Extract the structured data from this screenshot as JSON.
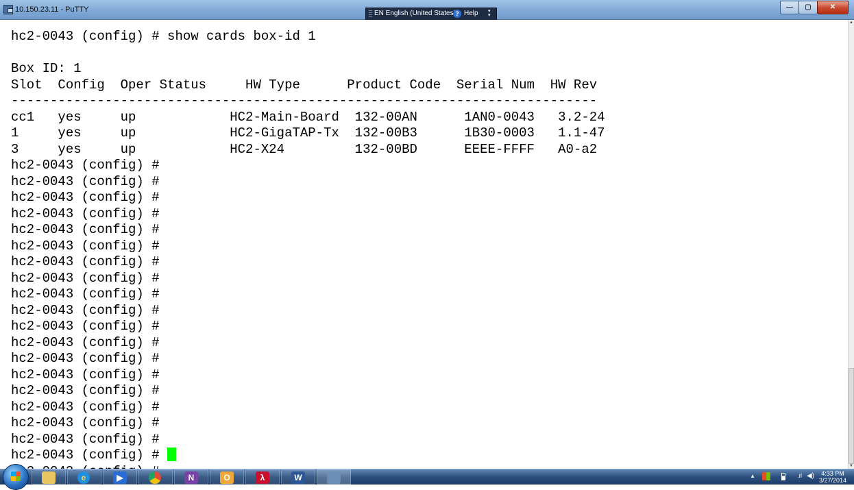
{
  "window": {
    "title": "10.150.23.11 - PuTTY",
    "minimize_icon": "minimize-icon",
    "maximize_icon": "maximize-icon",
    "close_icon": "close-icon"
  },
  "language_bar": {
    "language": "EN English (United States)",
    "help_label": "Help"
  },
  "terminal": {
    "lines": [
      "hc2-0043 (config) # show cards box-id 1",
      "",
      "Box ID: 1",
      "Slot  Config  Oper Status     HW Type      Product Code  Serial Num  HW Rev",
      "---------------------------------------------------------------------------",
      "cc1   yes     up            HC2-Main-Board  132-00AN      1AN0-0043   3.2-24",
      "1     yes     up            HC2-GigaTAP-Tx  132-00B3      1B30-0003   1.1-47",
      "3     yes     up            HC2-X24         132-00BD      EEEE-FFFF   A0-a2",
      "hc2-0043 (config) #",
      "hc2-0043 (config) #",
      "hc2-0043 (config) #",
      "hc2-0043 (config) #",
      "hc2-0043 (config) #",
      "hc2-0043 (config) #",
      "hc2-0043 (config) #",
      "hc2-0043 (config) #",
      "hc2-0043 (config) #",
      "hc2-0043 (config) #",
      "hc2-0043 (config) #",
      "hc2-0043 (config) #",
      "hc2-0043 (config) #",
      "hc2-0043 (config) #",
      "hc2-0043 (config) #",
      "hc2-0043 (config) #",
      "hc2-0043 (config) #",
      "hc2-0043 (config) #",
      "hc2-0043 (config) # ",
      "hc2-0043 (config) #"
    ],
    "cursor_color": "#00ff00"
  },
  "taskbar": {
    "apps": [
      {
        "name": "start-orb",
        "icon": "windows-logo-icon"
      },
      {
        "name": "explorer",
        "icon": "folder-icon",
        "glyph": ""
      },
      {
        "name": "internet-explorer",
        "icon": "ie-icon",
        "glyph": "e"
      },
      {
        "name": "media-player",
        "icon": "media-player-icon",
        "glyph": "▶"
      },
      {
        "name": "chrome",
        "icon": "chrome-icon",
        "glyph": ""
      },
      {
        "name": "onenote",
        "icon": "onenote-icon",
        "glyph": "N"
      },
      {
        "name": "outlook",
        "icon": "outlook-icon",
        "glyph": "O"
      },
      {
        "name": "acrobat",
        "icon": "acrobat-icon",
        "glyph": "λ"
      },
      {
        "name": "word",
        "icon": "word-icon",
        "glyph": "W"
      },
      {
        "name": "putty",
        "icon": "putty-icon",
        "glyph": ""
      }
    ],
    "clock_time": "4:33 PM",
    "clock_date": "3/27/2014"
  }
}
